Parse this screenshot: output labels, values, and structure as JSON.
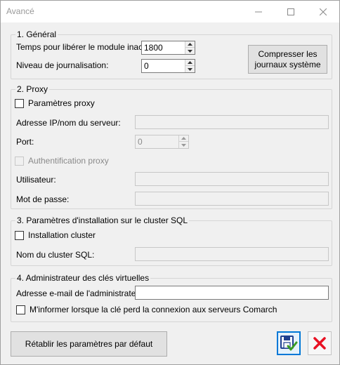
{
  "window": {
    "title": "Avancé"
  },
  "general": {
    "legend": "1. Général",
    "inactive_label": "Temps pour libérer le module inactif:",
    "inactive_value": "1800",
    "log_label": "Niveau de journalisation:",
    "log_value": "0",
    "compress_button": "Compresser les journaux système"
  },
  "proxy": {
    "legend": "2. Proxy",
    "params_checkbox": "Paramètres proxy",
    "address_label": "Adresse IP/nom du serveur:",
    "address_value": "",
    "port_label": "Port:",
    "port_value": "0",
    "auth_checkbox": "Authentification proxy",
    "user_label": "Utilisateur:",
    "user_value": "",
    "password_label": "Mot de passe:",
    "password_value": ""
  },
  "cluster": {
    "legend": "3. Paramètres d'installation sur le cluster SQL",
    "install_checkbox": "Installation cluster",
    "name_label": "Nom du cluster SQL:",
    "name_value": ""
  },
  "admin": {
    "legend": "4. Administrateur des clés virtuelles",
    "email_label": "Adresse e-mail de l'administrateur:",
    "email_value": "",
    "notify_checkbox": "M'informer lorsque la clé perd la connexion aux serveurs Comarch"
  },
  "footer": {
    "reset_button": "Rétablir les paramètres par défaut",
    "save_icon": "save-icon",
    "cancel_icon": "cancel-icon"
  },
  "colors": {
    "accent": "#0078d7",
    "cancel": "#e81123",
    "save_check": "#3a9d23"
  }
}
